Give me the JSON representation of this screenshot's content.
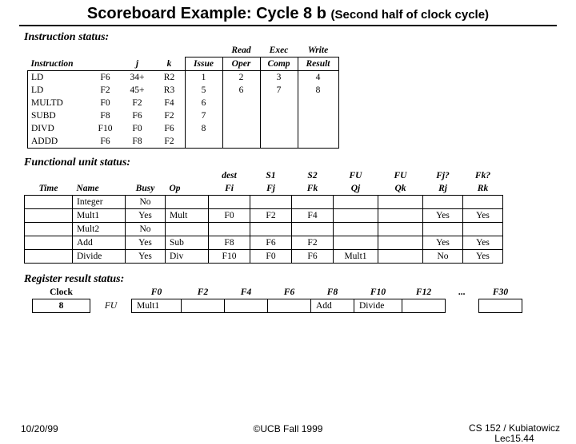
{
  "title_main": "Scoreboard Example: Cycle 8 b",
  "title_sub": "(Second half of clock cycle)",
  "sections": {
    "instr": "Instruction status:",
    "fus": "Functional unit status:",
    "rrs": "Register result status:"
  },
  "instr_headers": {
    "instruction": "Instruction",
    "j": "j",
    "k": "k",
    "issue": "Issue",
    "read": "Read",
    "oper": "Oper",
    "exec": "Exec",
    "comp": "Comp",
    "write": "Write",
    "result": "Result"
  },
  "instructions": [
    {
      "op": "LD",
      "dst": "F6",
      "j": "34+",
      "k": "R2",
      "issue": "1",
      "read": "2",
      "exec": "3",
      "write": "4"
    },
    {
      "op": "LD",
      "dst": "F2",
      "j": "45+",
      "k": "R3",
      "issue": "5",
      "read": "6",
      "exec": "7",
      "write": "8"
    },
    {
      "op": "MULTD",
      "dst": "F0",
      "j": "F2",
      "k": "F4",
      "issue": "6",
      "read": "",
      "exec": "",
      "write": ""
    },
    {
      "op": "SUBD",
      "dst": "F8",
      "j": "F6",
      "k": "F2",
      "issue": "7",
      "read": "",
      "exec": "",
      "write": ""
    },
    {
      "op": "DIVD",
      "dst": "F10",
      "j": "F0",
      "k": "F6",
      "issue": "8",
      "read": "",
      "exec": "",
      "write": ""
    },
    {
      "op": "ADDD",
      "dst": "F6",
      "j": "F8",
      "k": "F2",
      "issue": "",
      "read": "",
      "exec": "",
      "write": ""
    }
  ],
  "fu_headers": {
    "time": "Time",
    "name": "Name",
    "busy": "Busy",
    "op": "Op",
    "dest": "dest",
    "fi": "Fi",
    "s1": "S1",
    "fj": "Fj",
    "s2": "S2",
    "fk": "Fk",
    "fu1": "FU",
    "qj": "Qj",
    "fu2": "FU",
    "qk": "Qk",
    "fjq": "Fj?",
    "rj": "Rj",
    "fkq": "Fk?",
    "rk": "Rk"
  },
  "fu_rows": [
    {
      "name": "Integer",
      "busy": "No",
      "op": "",
      "fi": "",
      "fj": "",
      "fk": "",
      "qj": "",
      "qk": "",
      "rj": "",
      "rk": ""
    },
    {
      "name": "Mult1",
      "busy": "Yes",
      "op": "Mult",
      "fi": "F0",
      "fj": "F2",
      "fk": "F4",
      "qj": "",
      "qk": "",
      "rj": "Yes",
      "rk": "Yes"
    },
    {
      "name": "Mult2",
      "busy": "No",
      "op": "",
      "fi": "",
      "fj": "",
      "fk": "",
      "qj": "",
      "qk": "",
      "rj": "",
      "rk": ""
    },
    {
      "name": "Add",
      "busy": "Yes",
      "op": "Sub",
      "fi": "F8",
      "fj": "F6",
      "fk": "F2",
      "qj": "",
      "qk": "",
      "rj": "Yes",
      "rk": "Yes"
    },
    {
      "name": "Divide",
      "busy": "Yes",
      "op": "Div",
      "fi": "F10",
      "fj": "F0",
      "fk": "F6",
      "qj": "Mult1",
      "qk": "",
      "rj": "No",
      "rk": "Yes"
    }
  ],
  "reg_headers": {
    "clock": "Clock",
    "fu": "FU",
    "f0": "F0",
    "f2": "F2",
    "f4": "F4",
    "f6": "F6",
    "f8": "F8",
    "f10": "F10",
    "f12": "F12",
    "dots": "...",
    "f30": "F30"
  },
  "clock_val": "8",
  "reg_values": {
    "f0": "Mult1",
    "f2": "",
    "f4": "",
    "f6": "",
    "f8": "Add",
    "f10": "Divide",
    "f12": "",
    "f30": ""
  },
  "footer": {
    "date": "10/20/99",
    "center": "©UCB Fall 1999",
    "course": "CS 152 / Kubiatowicz",
    "lec": "Lec15.44"
  }
}
